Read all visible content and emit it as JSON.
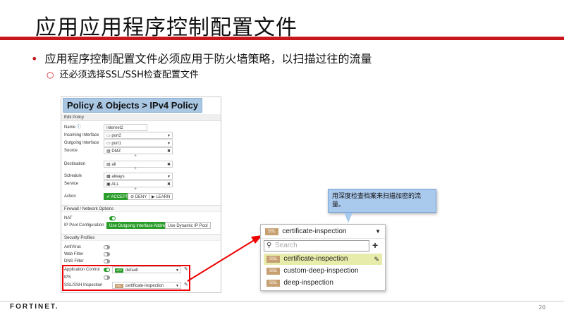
{
  "slide": {
    "title": "应用应用程序控制配置文件",
    "bullet": "应用程序控制配置文件必须应用于防火墙策略，以扫描过往的流量",
    "sub_bullet": "还必须选择SSL/SSH检查配置文件",
    "page_number": "20",
    "footer_logo": "FORTINET."
  },
  "policy": {
    "window_title": "Policy & Objects > IPv4 Policy",
    "section_header": "Edit Policy",
    "fields": {
      "name": {
        "label": "Name",
        "value": "Internet2"
      },
      "incoming": {
        "label": "Incoming Interface",
        "value": "port2"
      },
      "outgoing": {
        "label": "Outgoing Interface",
        "value": "port1"
      },
      "source": {
        "label": "Source",
        "value": "DMZ"
      },
      "destination": {
        "label": "Destination",
        "value": "all"
      },
      "schedule": {
        "label": "Schedule",
        "value": "always"
      },
      "service": {
        "label": "Service",
        "value": "ALL"
      }
    },
    "action": {
      "label": "Action",
      "buttons": [
        "✔ ACCEPT",
        "⊘ DENY",
        "▶ LEARN"
      ]
    },
    "firewall_network": {
      "header": "Firewall / Network Options",
      "nat_label": "NAT",
      "ip_pool_label": "IP Pool Configuration",
      "ip_pool_options": [
        "Use Outgoing Interface Address",
        "Use Dynamic IP Pool"
      ]
    },
    "security_profiles": {
      "header": "Security Profiles",
      "antivirus": "AntiVirus",
      "web_filter": "Web Filter",
      "dns_filter": "DNS Filter",
      "application_control": {
        "label": "Application Control",
        "badge": "APP",
        "value": "default"
      },
      "ips": "IPS",
      "ssl_ssh": {
        "label": "SSL/SSH Inspection",
        "badge": "SSL",
        "value": "certificate-inspection"
      }
    }
  },
  "dropdown": {
    "selected": "certificate-inspection",
    "search_placeholder": "Search",
    "badge": "SSL",
    "options": [
      "certificate-inspection",
      "custom-deep-inspection",
      "deep-inspection"
    ]
  },
  "tooltip": {
    "text": "用深度检查档案来扫描加密的流量。"
  },
  "colors": {
    "accent_red": "#c8161d",
    "accept_green": "#2a9d2a",
    "tooltip_blue": "#a9c9ed",
    "highlight_row": "#e8ecaa"
  }
}
